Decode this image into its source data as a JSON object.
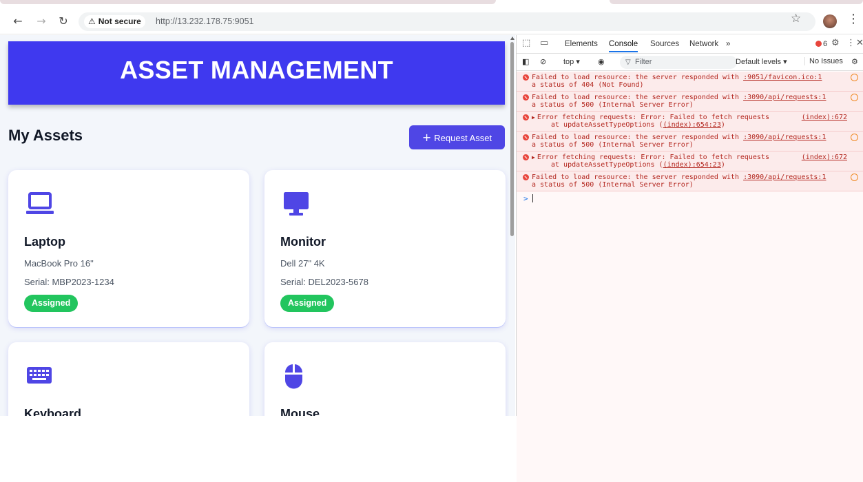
{
  "browser": {
    "security_label": "Not secure",
    "url": "http://13.232.178.75:9051",
    "icons": [
      "back-arrow-icon",
      "forward-arrow-icon",
      "reload-icon",
      "warning-icon",
      "star-icon",
      "profile-avatar",
      "kebab-menu-icon"
    ]
  },
  "page": {
    "banner_title": "ASSET MANAGEMENT",
    "section_title": "My Assets",
    "request_button": "Request Asset",
    "request_button_icon": "+",
    "colors": {
      "banner": "#3f39ef",
      "accent": "#4f46e5",
      "badge": "#22c55e"
    },
    "assets": [
      {
        "icon": "laptop-icon",
        "name": "Laptop",
        "model": "MacBook Pro 16\"",
        "serial": "Serial: MBP2023-1234",
        "status": "Assigned"
      },
      {
        "icon": "monitor-icon",
        "name": "Monitor",
        "model": "Dell 27\" 4K",
        "serial": "Serial: DEL2023-5678",
        "status": "Assigned"
      },
      {
        "icon": "keyboard-icon",
        "name": "Keyboard"
      },
      {
        "icon": "mouse-icon",
        "name": "Mouse"
      }
    ]
  },
  "devtools": {
    "tabs": [
      "Elements",
      "Console",
      "Sources",
      "Network"
    ],
    "more_tabs": "»",
    "active_tab": "Console",
    "error_count": "6",
    "context": "top ▾",
    "filter_placeholder": "Filter",
    "levels": "Default levels ▾",
    "issues": "No Issues",
    "messages": [
      {
        "line1": "Failed to load resource: the server responded with",
        "link": ":9051/favicon.ico:1",
        "line2": "a status of 404 (Not Found)"
      },
      {
        "line1": "Failed to load resource: the server responded with",
        "link": ":3090/api/requests:1",
        "line2": "a status of 500 (Internal Server Error)"
      },
      {
        "line1": "Error fetching requests: Error: Failed to fetch requests",
        "src": "(index):672",
        "line2_prefix": "at updateAssetTypeOptions (",
        "line2_link": "(index):654:23",
        "line2_suffix": ")"
      },
      {
        "line1": "Failed to load resource: the server responded with",
        "link": ":3090/api/requests:1",
        "line2": "a status of 500 (Internal Server Error)"
      },
      {
        "line1": "Error fetching requests: Error: Failed to fetch requests",
        "src": "(index):672",
        "line2_prefix": "at updateAssetTypeOptions (",
        "line2_link": "(index):654:23",
        "line2_suffix": ")"
      },
      {
        "line1": "Failed to load resource: the server responded with",
        "link": ":3090/api/requests:1",
        "line2": "a status of 500 (Internal Server Error)"
      }
    ],
    "prompt": ">"
  }
}
